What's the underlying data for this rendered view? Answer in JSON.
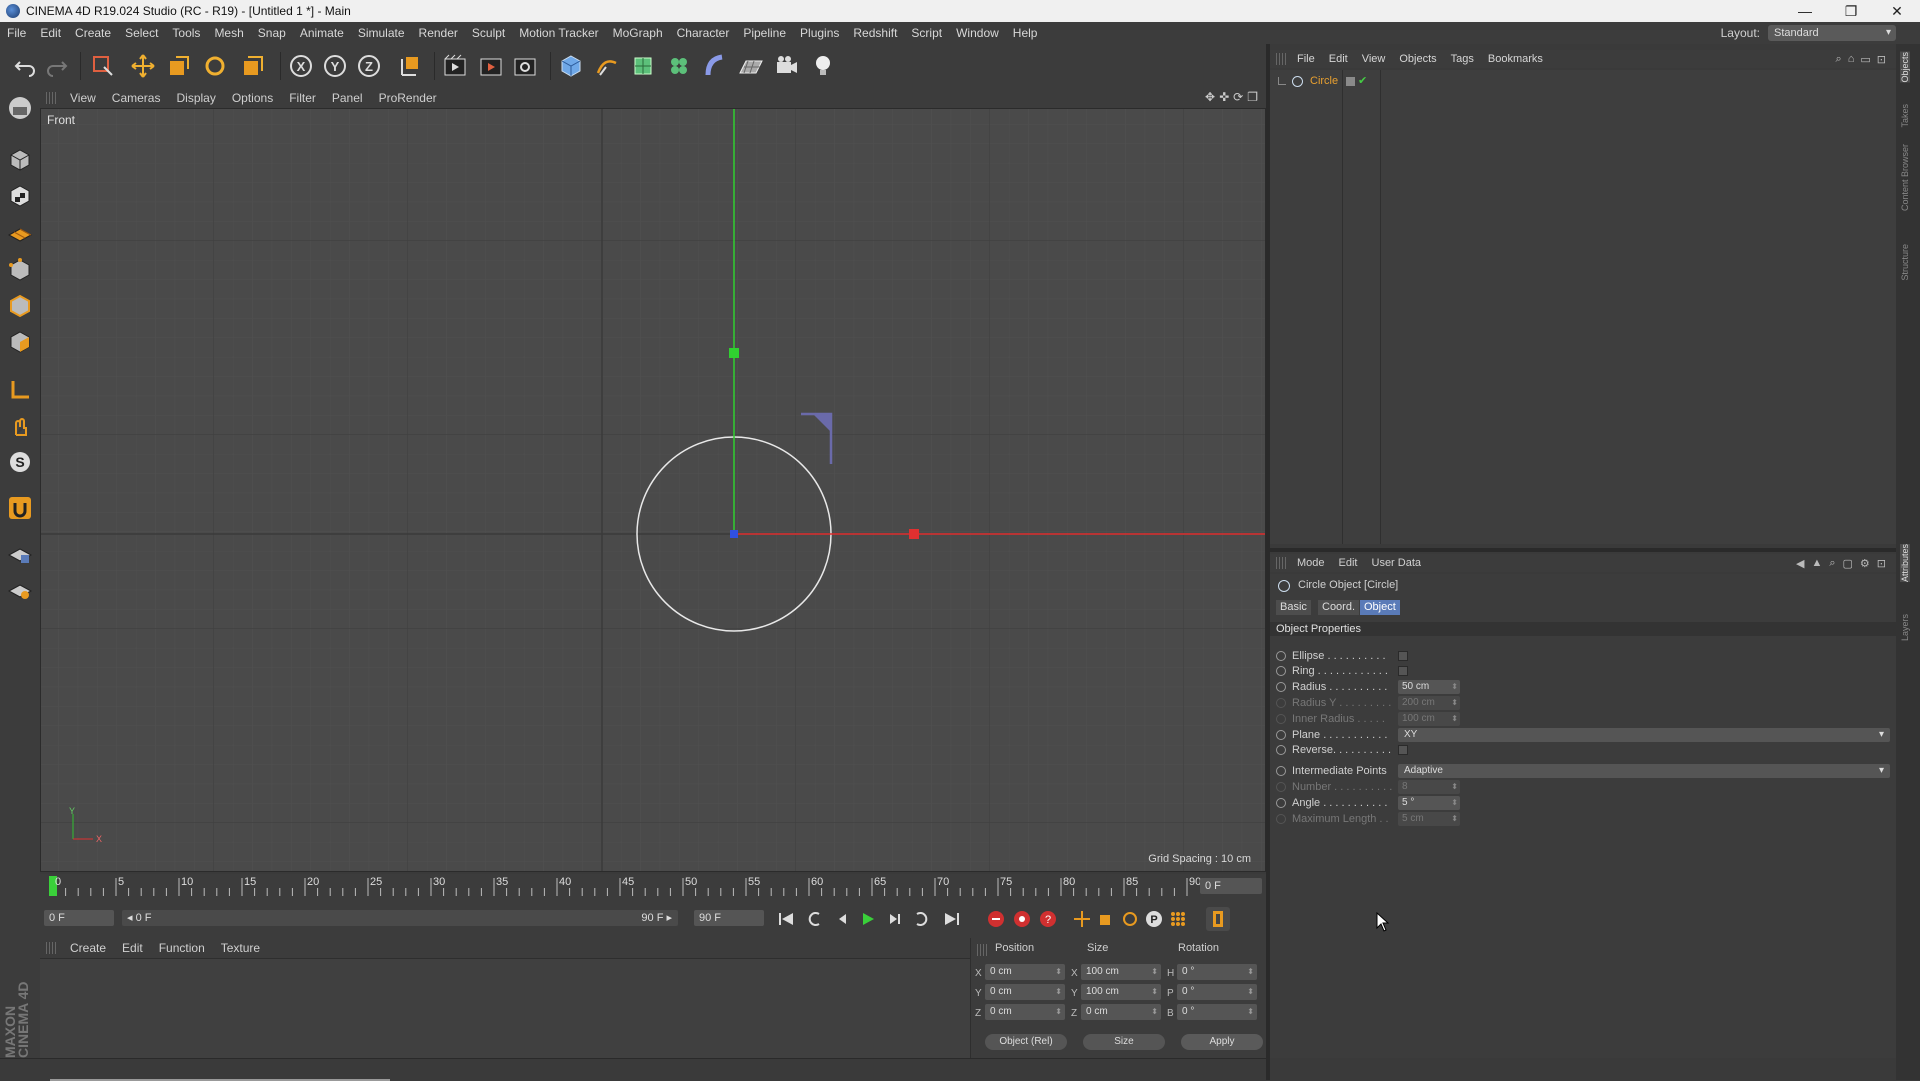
{
  "window": {
    "title": "CINEMA 4D R19.024 Studio (RC - R19) - [Untitled 1 *] - Main",
    "minimize": "—",
    "restore": "❐",
    "close": "✕"
  },
  "menu": [
    "File",
    "Edit",
    "Create",
    "Select",
    "Tools",
    "Mesh",
    "Snap",
    "Animate",
    "Simulate",
    "Render",
    "Sculpt",
    "Motion Tracker",
    "MoGraph",
    "Character",
    "Pipeline",
    "Plugins",
    "Redshift",
    "Script",
    "Window",
    "Help"
  ],
  "layout": {
    "label": "Layout:",
    "value": "Standard"
  },
  "viewport_menu": [
    "View",
    "Cameras",
    "Display",
    "Options",
    "Filter",
    "Panel",
    "ProRender"
  ],
  "viewport": {
    "name": "Front",
    "grid_spacing": "Grid Spacing : 10 cm",
    "axis_y": "Y",
    "axis_x": "X"
  },
  "timeline": {
    "ticks": [
      "0",
      "5",
      "10",
      "15",
      "20",
      "25",
      "30",
      "35",
      "40",
      "45",
      "50",
      "55",
      "60",
      "65",
      "70",
      "75",
      "80",
      "85",
      "90"
    ],
    "current_frame": "0 F",
    "start": "0 F",
    "range_start": "◂ 0 F",
    "range_end": "90 F ▸",
    "end": "90 F"
  },
  "material_menu": [
    "Create",
    "Edit",
    "Function",
    "Texture"
  ],
  "coords": {
    "headers": {
      "position": "Position",
      "size": "Size",
      "rotation": "Rotation"
    },
    "rows": [
      {
        "axis": "X",
        "pos": "0 cm",
        "saxis": "X",
        "size": "100 cm",
        "raxis": "H",
        "rot": "0 °"
      },
      {
        "axis": "Y",
        "pos": "0 cm",
        "saxis": "Y",
        "size": "100 cm",
        "raxis": "P",
        "rot": "0 °"
      },
      {
        "axis": "Z",
        "pos": "0 cm",
        "saxis": "Z",
        "size": "0 cm",
        "raxis": "B",
        "rot": "0 °"
      }
    ],
    "mode": "Object (Rel)",
    "size_mode": "Size",
    "apply": "Apply"
  },
  "objects_menu": [
    "File",
    "Edit",
    "View",
    "Objects",
    "Tags",
    "Bookmarks"
  ],
  "objects": [
    {
      "name": "Circle"
    }
  ],
  "attributes_menu": [
    "Mode",
    "Edit",
    "User Data"
  ],
  "attributes": {
    "object_title": "Circle Object [Circle]",
    "tabs": [
      "Basic",
      "Coord.",
      "Object"
    ],
    "active_tab": "Object",
    "section": "Object Properties",
    "props": [
      {
        "label": "Ellipse . . . . . . . . . .",
        "type": "check",
        "dim": false
      },
      {
        "label": "Ring . . . . . . . . . . . .",
        "type": "check",
        "dim": false
      },
      {
        "label": "Radius . . . . . . . . . .",
        "type": "value",
        "value": "50 cm",
        "dim": false
      },
      {
        "label": "Radius Y . . . . . . . . .",
        "type": "value",
        "value": "200 cm",
        "dim": true
      },
      {
        "label": "Inner Radius . . . . .",
        "type": "value",
        "value": "100 cm",
        "dim": true
      },
      {
        "label": "Plane . . . . . . . . . . .",
        "type": "dropdown",
        "value": "XY",
        "dim": false
      },
      {
        "label": "Reverse. . . . . . . . . .",
        "type": "check",
        "dim": false
      },
      {
        "label": "Intermediate Points",
        "type": "dropdown",
        "value": "Adaptive",
        "dim": false
      },
      {
        "label": "Number . . . . . . . . . .",
        "type": "value",
        "value": "8",
        "dim": true
      },
      {
        "label": "Angle . . . . . . . . . . .",
        "type": "value",
        "value": "5 °",
        "dim": false
      },
      {
        "label": "Maximum Length . .",
        "type": "value",
        "value": "5 cm",
        "dim": true
      }
    ]
  },
  "side_tabs": [
    "Objects",
    "Takes",
    "Content Browser",
    "Structure",
    "Attributes",
    "Layers"
  ],
  "brand": {
    "line1": "MAXON",
    "line2": "CINEMA 4D"
  }
}
